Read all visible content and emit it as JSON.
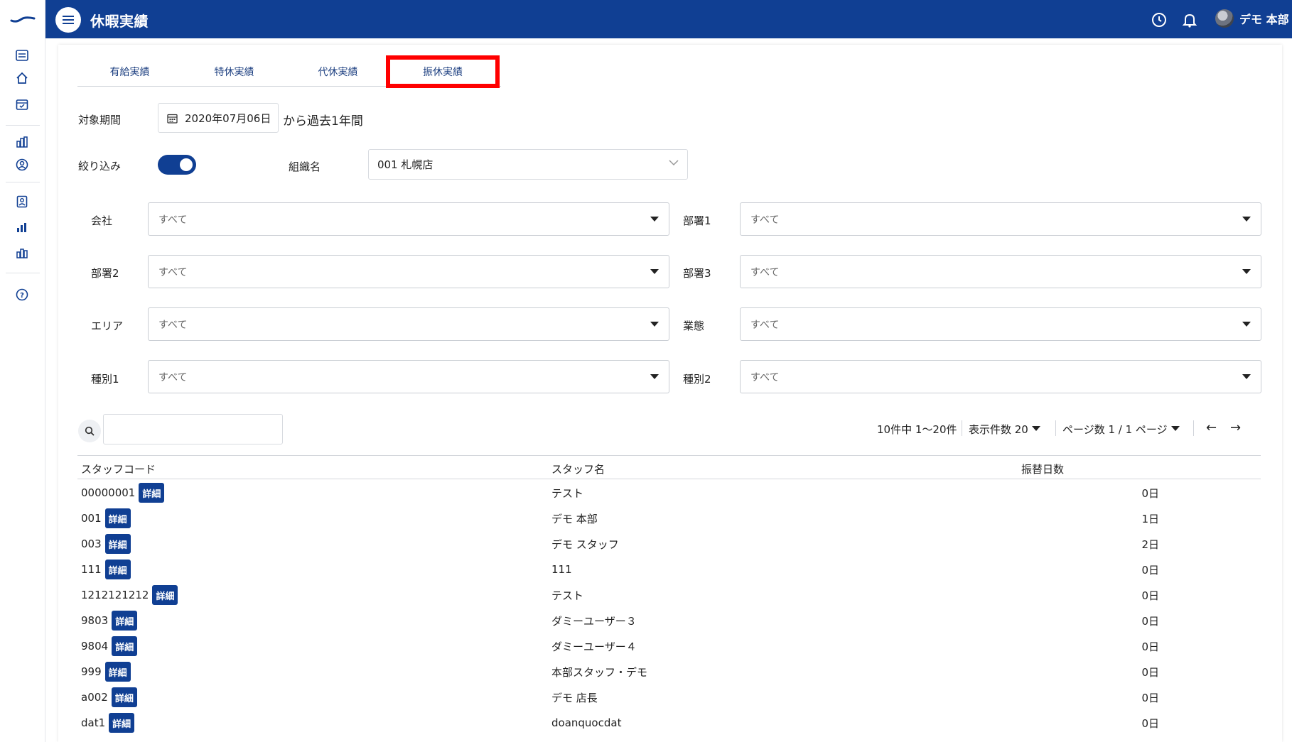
{
  "header": {
    "title": "休暇実績",
    "user_name": "デモ 本部"
  },
  "tabs": [
    {
      "label": "有給実績",
      "active": false
    },
    {
      "label": "特休実績",
      "active": false
    },
    {
      "label": "代休実績",
      "active": false
    },
    {
      "label": "振休実績",
      "active": true
    }
  ],
  "period": {
    "label": "対象期間",
    "date": "2020年07月06日",
    "suffix": "から過去1年間"
  },
  "narrow": {
    "label": "絞り込み",
    "enabled": true,
    "org_label": "組織名",
    "org_value": "001 札幌店"
  },
  "filters": [
    {
      "label": "会社",
      "value": "すべて"
    },
    {
      "label": "部署1",
      "value": "すべて"
    },
    {
      "label": "部署2",
      "value": "すべて"
    },
    {
      "label": "部署3",
      "value": "すべて"
    },
    {
      "label": "エリア",
      "value": "すべて"
    },
    {
      "label": "業態",
      "value": "すべて"
    },
    {
      "label": "種別1",
      "value": "すべて"
    },
    {
      "label": "種別2",
      "value": "すべて"
    }
  ],
  "search": {
    "value": "",
    "placeholder": ""
  },
  "pager": {
    "summary": "10件中 1〜20件",
    "per_page": "表示件数 20",
    "pages": "ページ数 1 / 1 ページ",
    "prev": "←",
    "next": "→"
  },
  "table": {
    "columns": [
      "スタッフコード",
      "スタッフ名",
      "振替日数"
    ],
    "detail_label": "詳細",
    "rows": [
      {
        "code": "00000001",
        "name": "テスト",
        "days": "0日"
      },
      {
        "code": "001",
        "name": "デモ 本部",
        "days": "1日"
      },
      {
        "code": "003",
        "name": "デモ スタッフ",
        "days": "2日"
      },
      {
        "code": "111",
        "name": "111",
        "days": "0日"
      },
      {
        "code": "1212121212",
        "name": "テスト",
        "days": "0日"
      },
      {
        "code": "9803",
        "name": "ダミーユーザー３",
        "days": "0日"
      },
      {
        "code": "9804",
        "name": "ダミーユーザー４",
        "days": "0日"
      },
      {
        "code": "999",
        "name": "本部スタッフ・デモ",
        "days": "0日"
      },
      {
        "code": "a002",
        "name": "デモ 店長",
        "days": "0日"
      },
      {
        "code": "dat1",
        "name": "doanquocdat",
        "days": "0日"
      }
    ]
  },
  "colors": {
    "brand": "#103f93",
    "highlight": "#ff0000"
  }
}
